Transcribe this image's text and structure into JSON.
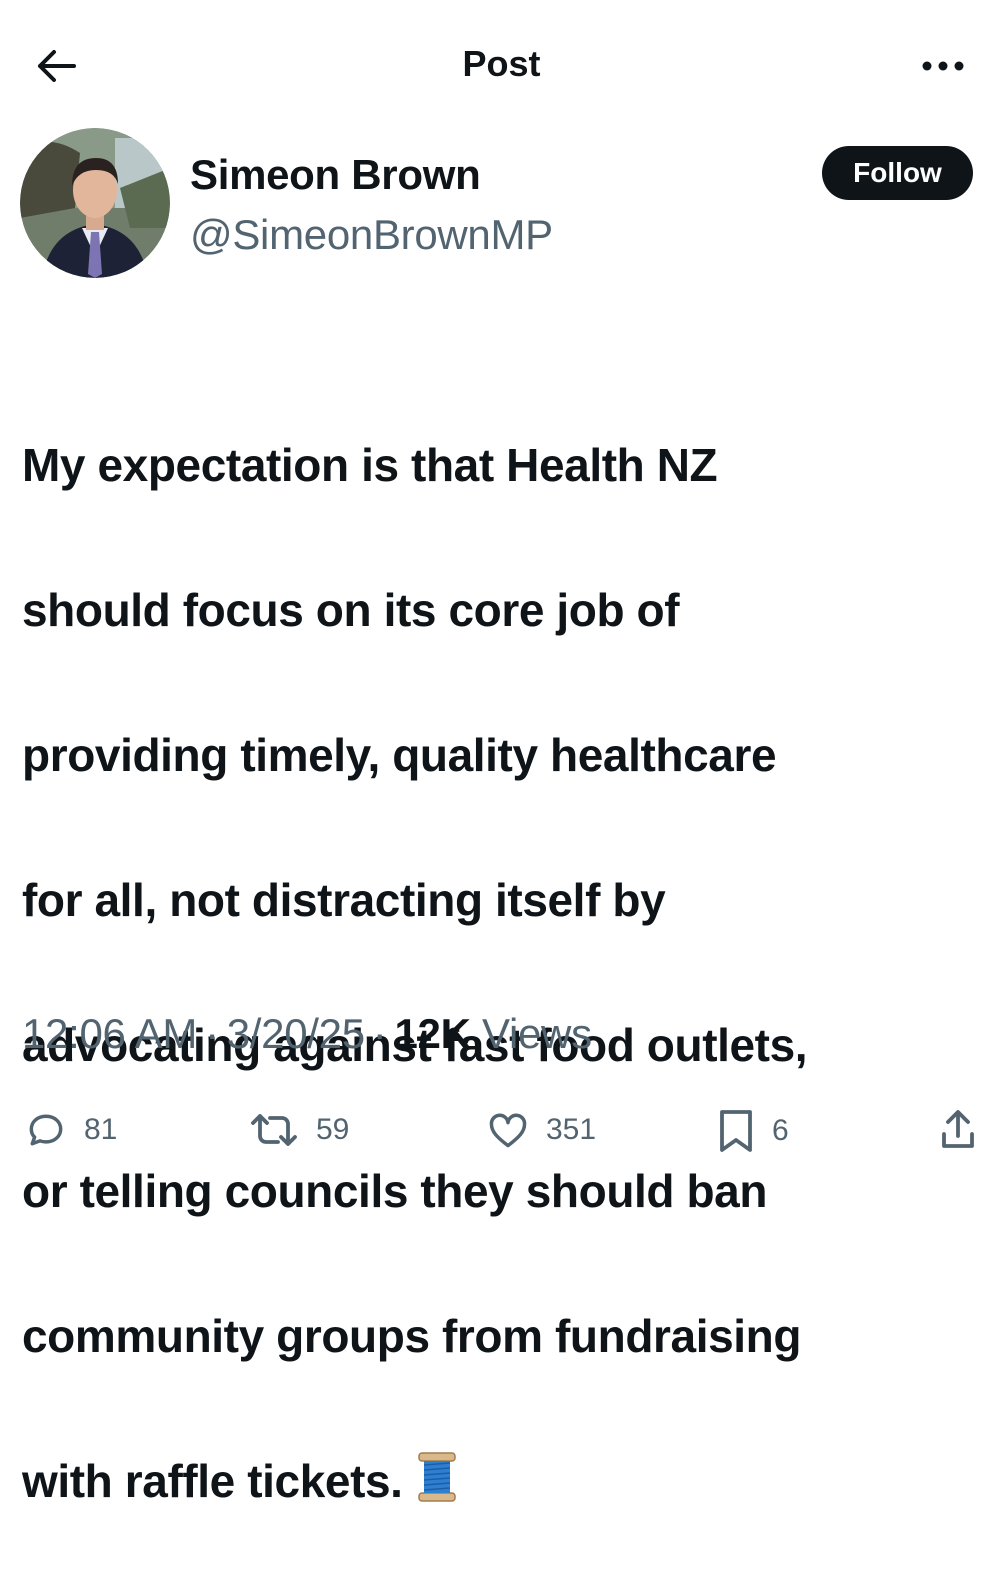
{
  "header": {
    "title": "Post",
    "back_icon": "arrow-left-icon",
    "more_icon": "more-horizontal-icon"
  },
  "author": {
    "name": "Simeon Brown",
    "handle": "@SimeonBrownMP",
    "follow_label": "Follow"
  },
  "post": {
    "lines": [
      "My expectation is that Health NZ",
      "should focus on its core job of",
      "providing timely, quality healthcare",
      "for all, not distracting itself by",
      "advocating against fast food outlets,",
      "or telling councils they should ban",
      "community groups from fundraising",
      "with raffle tickets."
    ],
    "emoji": "thread-spool-emoji"
  },
  "meta": {
    "time": "12:06 AM",
    "separator": "·",
    "date": "3/20/25",
    "views_count": "12K",
    "views_label": "Views"
  },
  "actions": {
    "replies": "81",
    "reposts": "59",
    "likes": "351",
    "bookmarks": "6"
  },
  "colors": {
    "text": "#0f1419",
    "secondary": "#536471",
    "follow_bg": "#0f1419",
    "background": "#ffffff"
  }
}
